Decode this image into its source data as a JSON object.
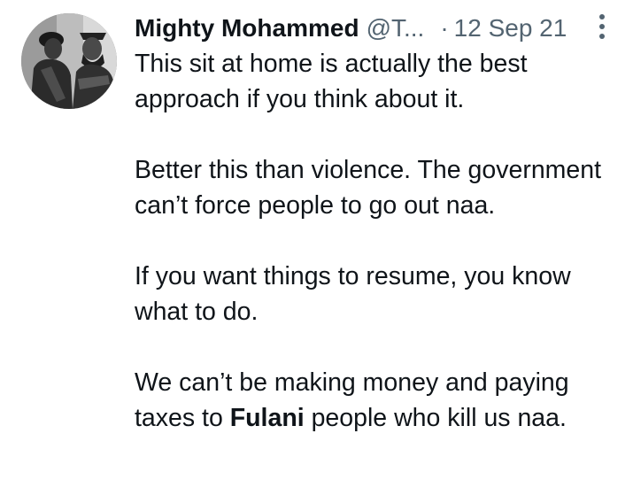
{
  "tweet": {
    "author": {
      "display_name": "Mighty Mohammed",
      "handle": "@T...",
      "avatar_icon": "profile-photo"
    },
    "separator": "·",
    "date": "12 Sep 21",
    "more_icon": "more-vertical-icon",
    "paragraphs": [
      {
        "text": "This sit at home is actually the best approach if you think about it."
      },
      {
        "text": "Better this than violence. The government can’t force people to go out naa."
      },
      {
        "text": "If you want things to resume, you know what to do."
      },
      {
        "before": "We can’t be making money and paying taxes to ",
        "bold": "Fulani",
        "after": " people who kill us naa."
      }
    ]
  }
}
